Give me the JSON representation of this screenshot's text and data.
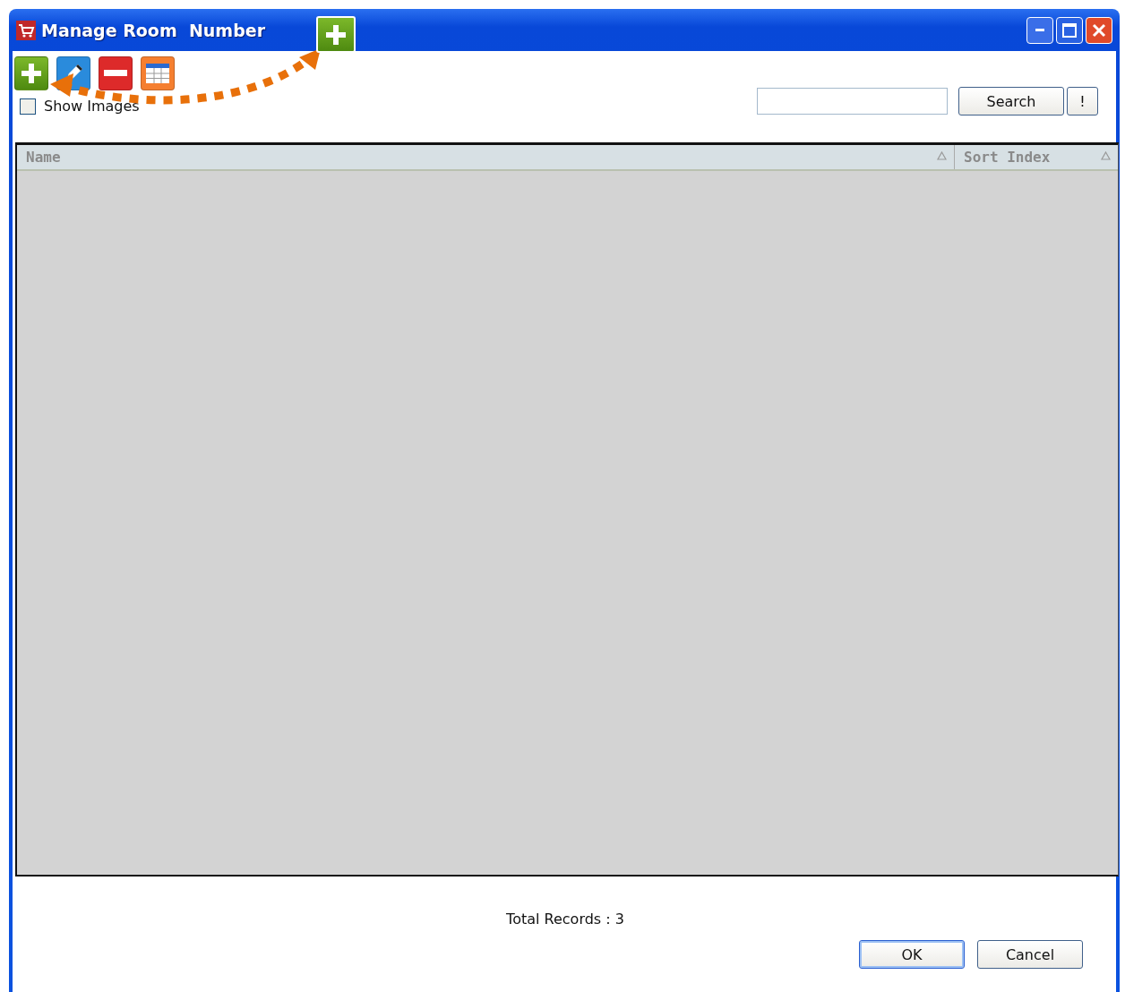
{
  "window": {
    "title": "Manage Room  Number"
  },
  "callout_button": {
    "kind": "add"
  },
  "toolbar": [
    {
      "kind": "add"
    },
    {
      "kind": "edit"
    },
    {
      "kind": "delete"
    },
    {
      "kind": "grid"
    }
  ],
  "show_images": {
    "label": "Show Images",
    "checked": false
  },
  "search": {
    "button": "Search",
    "clear_button": "!"
  },
  "table": {
    "columns": [
      {
        "label": "Name"
      },
      {
        "label": "Sort Index"
      }
    ]
  },
  "footer": {
    "total": "Total Records : 3"
  },
  "buttons": [
    {
      "label": "OK",
      "selected": true
    },
    {
      "label": "Cancel",
      "selected": false
    }
  ]
}
